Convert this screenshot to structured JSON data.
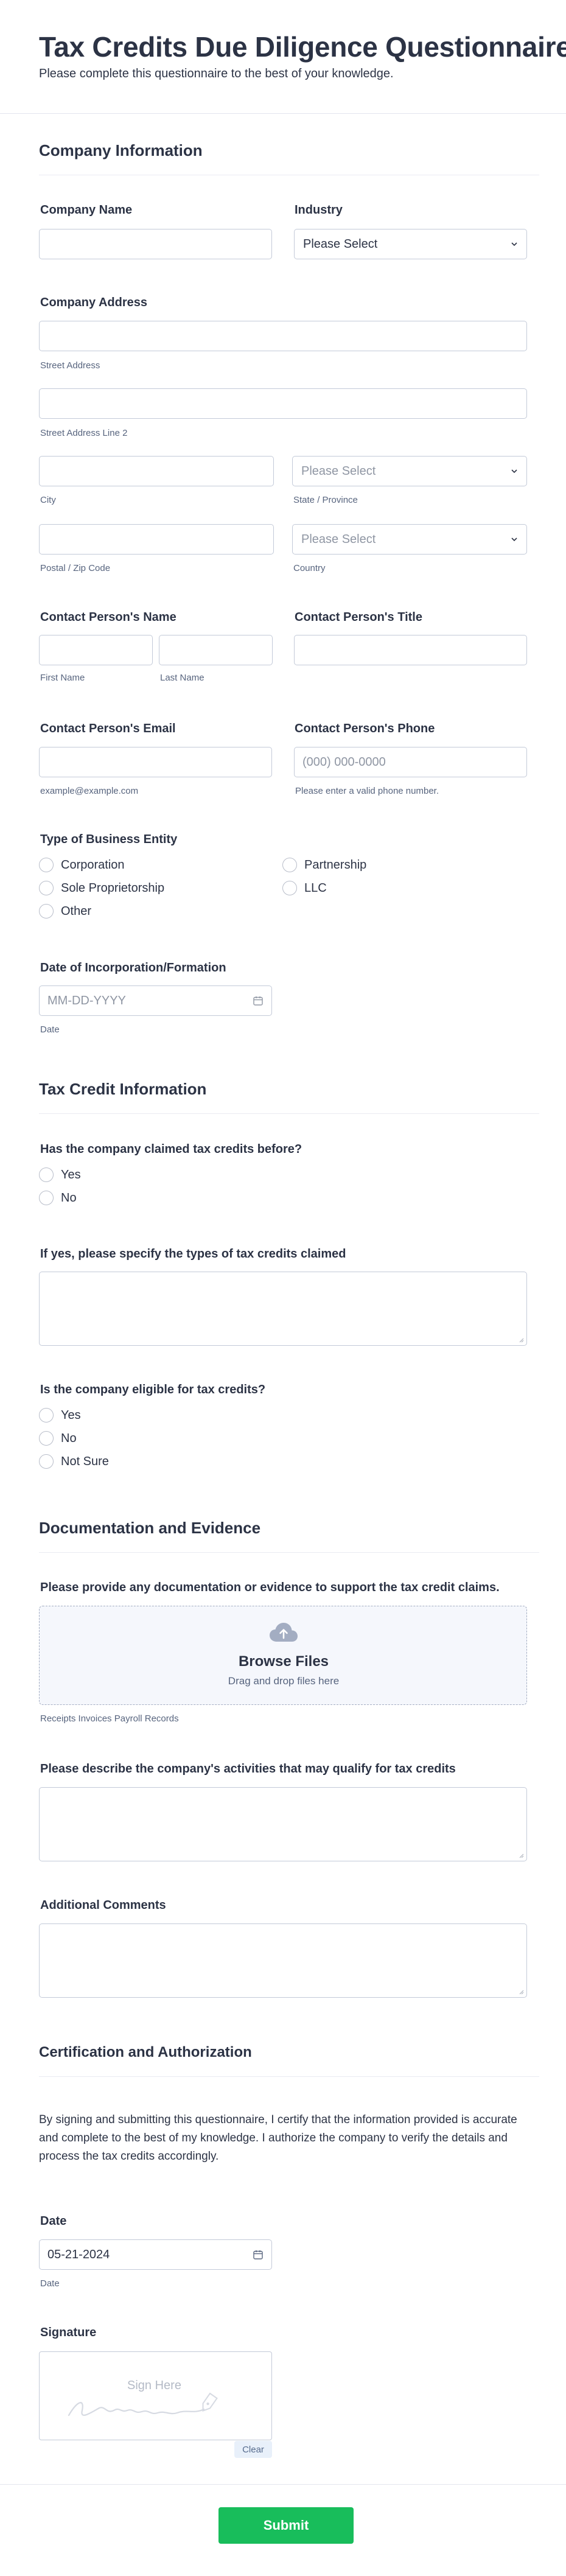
{
  "header": {
    "title": "Tax Credits Due Diligence Questionnaire",
    "subtitle": "Please complete this questionnaire to the best of your knowledge."
  },
  "company": {
    "section_title": "Company Information",
    "name_label": "Company Name",
    "name_value": "",
    "industry_label": "Industry",
    "industry_value": "Please Select",
    "address_label": "Company Address",
    "street_label": "Street Address",
    "street2_label": "Street Address Line 2",
    "city_label": "City",
    "state_label": "State / Province",
    "state_value": "Please Select",
    "postal_label": "Postal / Zip Code",
    "country_label": "Country",
    "country_value": "Please Select",
    "contact_name_label": "Contact Person's Name",
    "first_name_label": "First Name",
    "last_name_label": "Last Name",
    "contact_title_label": "Contact Person's Title",
    "contact_email_label": "Contact Person's Email",
    "email_hint": "example@example.com",
    "contact_phone_label": "Contact Person's Phone",
    "phone_placeholder": "(000) 000-0000",
    "phone_hint": "Please enter a valid phone number.",
    "entity_label": "Type of Business Entity",
    "entity_options": [
      "Corporation",
      "Partnership",
      "Sole Proprietorship",
      "LLC",
      "Other"
    ],
    "incorporation_label": "Date of Incorporation/Formation",
    "incorporation_placeholder": "MM-DD-YYYY",
    "incorporation_sublabel": "Date"
  },
  "tax_credit": {
    "section_title": "Tax Credit Information",
    "claimed_before_label": "Has the company claimed tax credits before?",
    "claimed_options": [
      "Yes",
      "No"
    ],
    "types_label": "If yes, please specify the types of tax credits claimed",
    "eligible_label": "Is the company eligible for tax credits?",
    "eligible_options": [
      "Yes",
      "No",
      "Not Sure"
    ]
  },
  "documentation": {
    "section_title": "Documentation and Evidence",
    "evidence_label": "Please provide any documentation or evidence to support the tax credit claims.",
    "browse_label": "Browse Files",
    "drag_label": "Drag and drop files here",
    "upload_sublabel": "Receipts Invoices Payroll Records",
    "activities_label": "Please describe the company's activities that may qualify for tax credits",
    "comments_label": "Additional Comments"
  },
  "certification": {
    "section_title": "Certification and Authorization",
    "statement": "By signing and submitting this questionnaire, I certify that the information provided is accurate and complete to the best of my knowledge. I authorize the company to verify the details and process the tax credits accordingly.",
    "date_label": "Date",
    "date_value": "05-21-2024",
    "date_sublabel": "Date",
    "signature_label": "Signature",
    "sign_here": "Sign Here",
    "clear_label": "Clear"
  },
  "footer": {
    "submit_label": "Submit"
  },
  "colors": {
    "accent_submit": "#18bd5b",
    "text": "#2c3345",
    "border": "#c3cad8"
  }
}
